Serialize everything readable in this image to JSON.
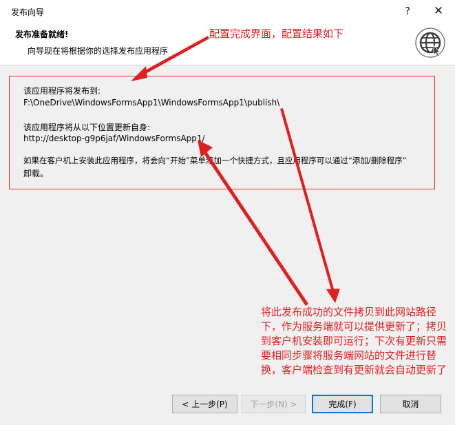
{
  "window": {
    "title": "发布向导",
    "help_glyph": "?",
    "close_glyph": "✕"
  },
  "header": {
    "title": "发布准备就绪!",
    "subtitle": "向导现在将根据你的选择发布应用程序"
  },
  "annotations": {
    "top": "配置完成界面，配置结果如下",
    "big": "将此发布成功的文件拷贝到此网站路径下，作为服务端就可以提供更新了；拷贝到客户机安装即可运行；下次有更新只需要相同步骤将服务端网站的文件进行替换，客户端检查到有更新就会自动更新了"
  },
  "info": {
    "publish_label": "该应用程序将发布到:",
    "publish_path": "F:\\OneDrive\\WindowsFormsApp1\\WindowsFormsApp1\\publish\\",
    "update_label": "该应用程序将从以下位置更新自身:",
    "update_url": "http://desktop-g9p6jaf/WindowsFormsApp1/",
    "install_note_1": "如果在客户机上安装此应用程序，将会向“开始”菜单添加一个快捷方式，且应用程序可以通过“添加/删除程序”",
    "install_note_2": "卸载。"
  },
  "buttons": {
    "prev": "< 上一步(P)",
    "next": "下一步(N) >",
    "finish": "完成(F)",
    "cancel": "取消"
  },
  "colors": {
    "annotation": "#e02020",
    "accent": "#0078d7"
  },
  "icons": {
    "header_icon": "globe-icon"
  }
}
